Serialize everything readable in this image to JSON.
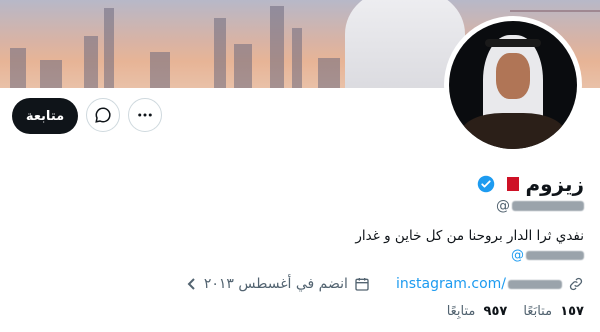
{
  "profile": {
    "name": "زيزوم",
    "handle_prefix": "@",
    "bio": "نفدي ثرا الدار بروحنا من كل خاين و غدار",
    "bio_link_prefix": "@",
    "website": "instagram.com/",
    "joined": "انضم في أغسطس ٢٠١٣",
    "following_count": "١٥٧",
    "following_label": "متابَعًا",
    "followers_count": "٩٥٧",
    "followers_label": "متابِعًا"
  },
  "actions": {
    "follow_label": "متابعة"
  },
  "icons": {
    "more": "more-icon",
    "message": "message-icon",
    "verified": "verified-badge-icon",
    "flag": "bahrain-flag-icon",
    "link": "link-icon",
    "calendar": "calendar-icon"
  },
  "colors": {
    "accent": "#1d9bf0",
    "text": "#0f1419",
    "muted": "#536471"
  }
}
